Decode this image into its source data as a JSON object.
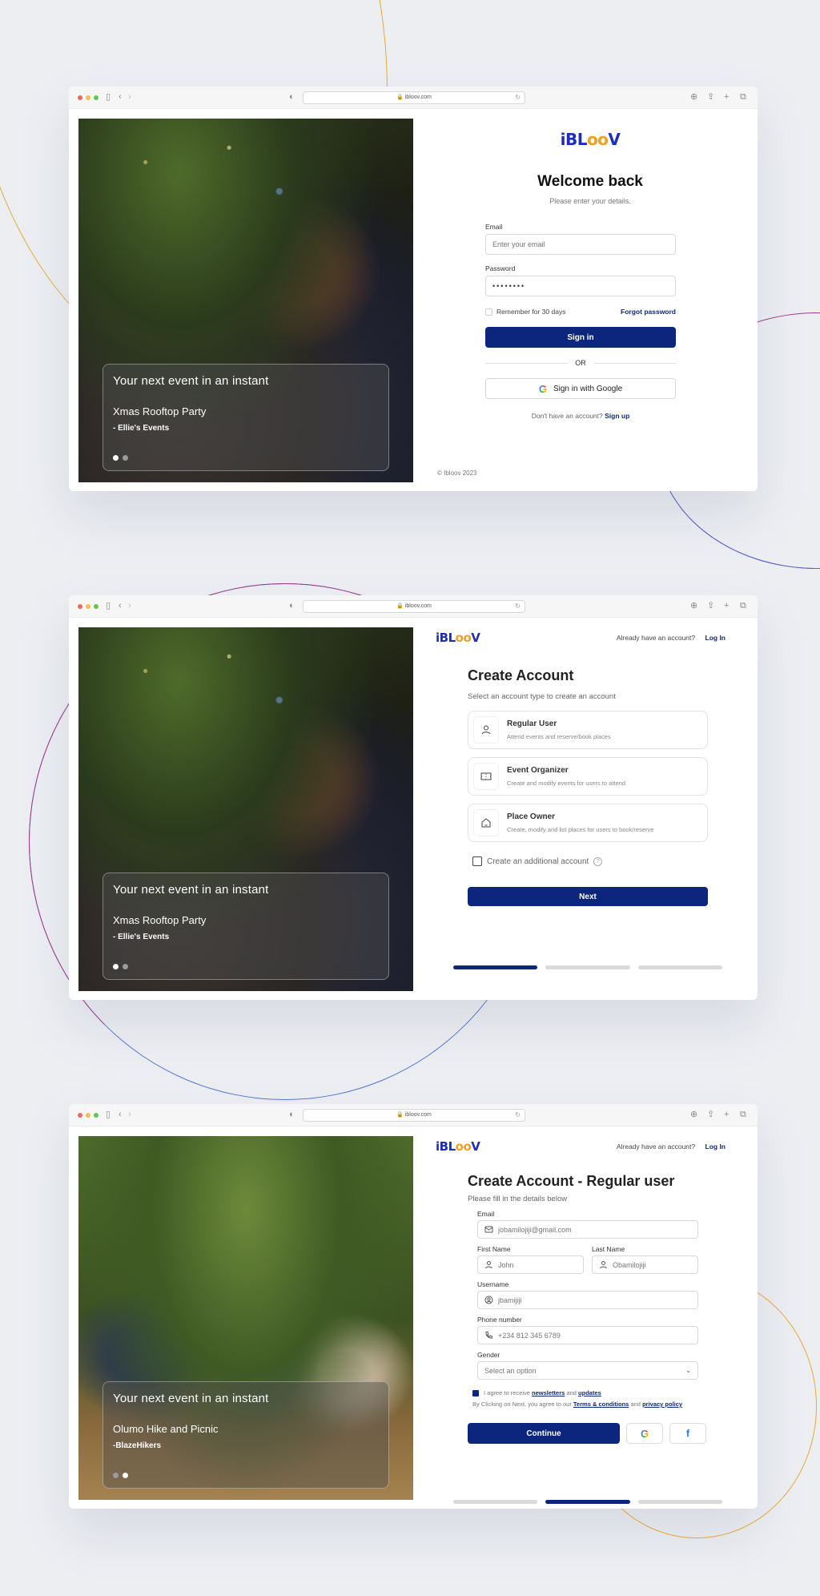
{
  "browser": {
    "url": "ibloov.com",
    "traffic_lights": [
      "#ed6a5e",
      "#f5bf4f",
      "#61c554"
    ]
  },
  "brand": {
    "logo_text_a": "iBL",
    "logo_text_b": "oo",
    "logo_text_c": "V",
    "primary_color": "#0c267e",
    "accent_color": "#f0a020"
  },
  "carousel": {
    "party": {
      "title": "Your next event in an instant",
      "event": "Xmas Rooftop Party",
      "organizer": "- Ellie's Events",
      "active_index": 0,
      "count": 2
    },
    "hike": {
      "title": "Your next event in an instant",
      "event": "Olumo Hike and Picnic",
      "organizer": "-BlazeHikers",
      "active_index": 1,
      "count": 2
    }
  },
  "login": {
    "title": "Welcome back",
    "subtitle": "Please enter your details.",
    "email_label": "Email",
    "email_placeholder": "Enter your email",
    "password_label": "Password",
    "password_value": "••••••••",
    "remember_label": "Remember for 30 days",
    "forgot_label": "Forgot password",
    "sign_in_label": "Sign in",
    "or_label": "OR",
    "google_label": "Sign in with Google",
    "no_account_text": "Don't have an account?",
    "sign_up_label": "Sign up",
    "copyright": "© Ibloov 2023"
  },
  "header": {
    "already_text": "Already have an account?",
    "login_label": "Log In"
  },
  "account_type": {
    "title": "Create Account",
    "subtitle": "Select an account type to create an account",
    "types": [
      {
        "icon": "user-icon",
        "title": "Regular User",
        "desc": "Attend events and reserve/book places"
      },
      {
        "icon": "ticket-icon",
        "title": "Event Organizer",
        "desc": "Create and modify events for users to attend"
      },
      {
        "icon": "home-icon",
        "title": "Place Owner",
        "desc": "Create, modify and list places for users to book/reserve"
      }
    ],
    "additional_label": "Create an additional account",
    "next_label": "Next",
    "progress_step": 1,
    "progress_total": 3
  },
  "regular_form": {
    "title": "Create Account - Regular user",
    "subtitle": "Please fill in the details below",
    "email_label": "Email",
    "email_value": "jobamilojiji@gmail.com",
    "first_name_label": "First Name",
    "first_name_value": "John",
    "last_name_label": "Last Name",
    "last_name_value": "Obamilojiji",
    "username_label": "Username",
    "username_value": "jbamijiji",
    "phone_label": "Phone number",
    "phone_value": "+234 812 345 6789",
    "gender_label": "Gender",
    "gender_placeholder": "Select an option",
    "agree_prefix": "I agree to receive",
    "agree_newsletters": "newsletters",
    "agree_and": "and",
    "agree_updates": "updates",
    "agree_checked": true,
    "terms_prefix": "By Clicking on Next, you agree to our",
    "terms_link": "Terms & conditions",
    "terms_and": "and",
    "privacy_link": "privacy policy",
    "continue_label": "Continue",
    "google_glyph": "G",
    "facebook_glyph": "f",
    "progress_step": 2,
    "progress_total": 3
  }
}
